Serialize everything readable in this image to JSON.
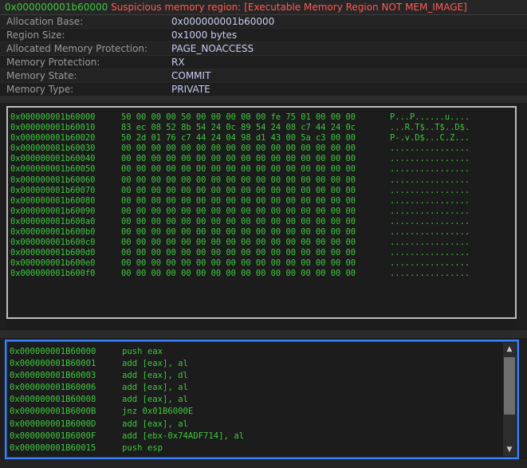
{
  "header": {
    "address": "0x000000001b60000",
    "message": "Suspicious memory region: [Executable Memory Region NOT MEM_IMAGE]"
  },
  "info": [
    {
      "label": "Allocation Base:",
      "value": "0x000000001b60000"
    },
    {
      "label": "Region Size:",
      "value": "0x1000 bytes"
    },
    {
      "label": "Allocated Memory Protection:",
      "value": "PAGE_NOACCESS"
    },
    {
      "label": "Memory Protection:",
      "value": "RX"
    },
    {
      "label": "Memory State:",
      "value": "COMMIT"
    },
    {
      "label": "Memory Type:",
      "value": "PRIVATE"
    }
  ],
  "hexdump": [
    {
      "addr": "0x000000001b60000",
      "bytes": "50 00 00 00 50 00 00 00 00 00 fe 75 01 00 00 00",
      "ascii": "P...P......u...."
    },
    {
      "addr": "0x000000001b60010",
      "bytes": "83 ec 08 52 8b 54 24 0c 89 54 24 08 c7 44 24 0c",
      "ascii": "...R.T$..T$..D$."
    },
    {
      "addr": "0x000000001b60020",
      "bytes": "50 2d 01 76 c7 44 24 04 98 d1 43 00 5a c3 00 00",
      "ascii": "P-.v.D$...C.Z..."
    },
    {
      "addr": "0x000000001b60030",
      "bytes": "00 00 00 00 00 00 00 00 00 00 00 00 00 00 00 00",
      "ascii": "................"
    },
    {
      "addr": "0x000000001b60040",
      "bytes": "00 00 00 00 00 00 00 00 00 00 00 00 00 00 00 00",
      "ascii": "................"
    },
    {
      "addr": "0x000000001b60050",
      "bytes": "00 00 00 00 00 00 00 00 00 00 00 00 00 00 00 00",
      "ascii": "................"
    },
    {
      "addr": "0x000000001b60060",
      "bytes": "00 00 00 00 00 00 00 00 00 00 00 00 00 00 00 00",
      "ascii": "................"
    },
    {
      "addr": "0x000000001b60070",
      "bytes": "00 00 00 00 00 00 00 00 00 00 00 00 00 00 00 00",
      "ascii": "................"
    },
    {
      "addr": "0x000000001b60080",
      "bytes": "00 00 00 00 00 00 00 00 00 00 00 00 00 00 00 00",
      "ascii": "................"
    },
    {
      "addr": "0x000000001b60090",
      "bytes": "00 00 00 00 00 00 00 00 00 00 00 00 00 00 00 00",
      "ascii": "................"
    },
    {
      "addr": "0x000000001b600a0",
      "bytes": "00 00 00 00 00 00 00 00 00 00 00 00 00 00 00 00",
      "ascii": "................"
    },
    {
      "addr": "0x000000001b600b0",
      "bytes": "00 00 00 00 00 00 00 00 00 00 00 00 00 00 00 00",
      "ascii": "................"
    },
    {
      "addr": "0x000000001b600c0",
      "bytes": "00 00 00 00 00 00 00 00 00 00 00 00 00 00 00 00",
      "ascii": "................"
    },
    {
      "addr": "0x000000001b600d0",
      "bytes": "00 00 00 00 00 00 00 00 00 00 00 00 00 00 00 00",
      "ascii": "................"
    },
    {
      "addr": "0x000000001b600e0",
      "bytes": "00 00 00 00 00 00 00 00 00 00 00 00 00 00 00 00",
      "ascii": "................"
    },
    {
      "addr": "0x000000001b600f0",
      "bytes": "00 00 00 00 00 00 00 00 00 00 00 00 00 00 00 00",
      "ascii": "................"
    }
  ],
  "disassembly": [
    {
      "addr": "0x000000001B60000",
      "instr": "push eax"
    },
    {
      "addr": "0x000000001B60001",
      "instr": "add [eax], al"
    },
    {
      "addr": "0x000000001B60003",
      "instr": "add [eax], dl"
    },
    {
      "addr": "0x000000001B60006",
      "instr": "add [eax], al"
    },
    {
      "addr": "0x000000001B60008",
      "instr": "add [eax], al"
    },
    {
      "addr": "0x000000001B6000B",
      "instr": "jnz 0x01B6000E"
    },
    {
      "addr": "0x000000001B6000D",
      "instr": "add [eax], al"
    },
    {
      "addr": "0x000000001B6000F",
      "instr": "add [ebx-0x74ADF714], al"
    },
    {
      "addr": "0x000000001B60015",
      "instr": "push esp"
    }
  ],
  "scrollbar": {
    "up_icon": "triangle-up-icon",
    "down_icon": "triangle-down-icon"
  },
  "colors": {
    "background": "#1e1e1e",
    "address_green": "#3cc83c",
    "alert_red": "#ff5a5a",
    "value_blue": "#c7cef0",
    "focus_blue": "#3b82f6"
  }
}
